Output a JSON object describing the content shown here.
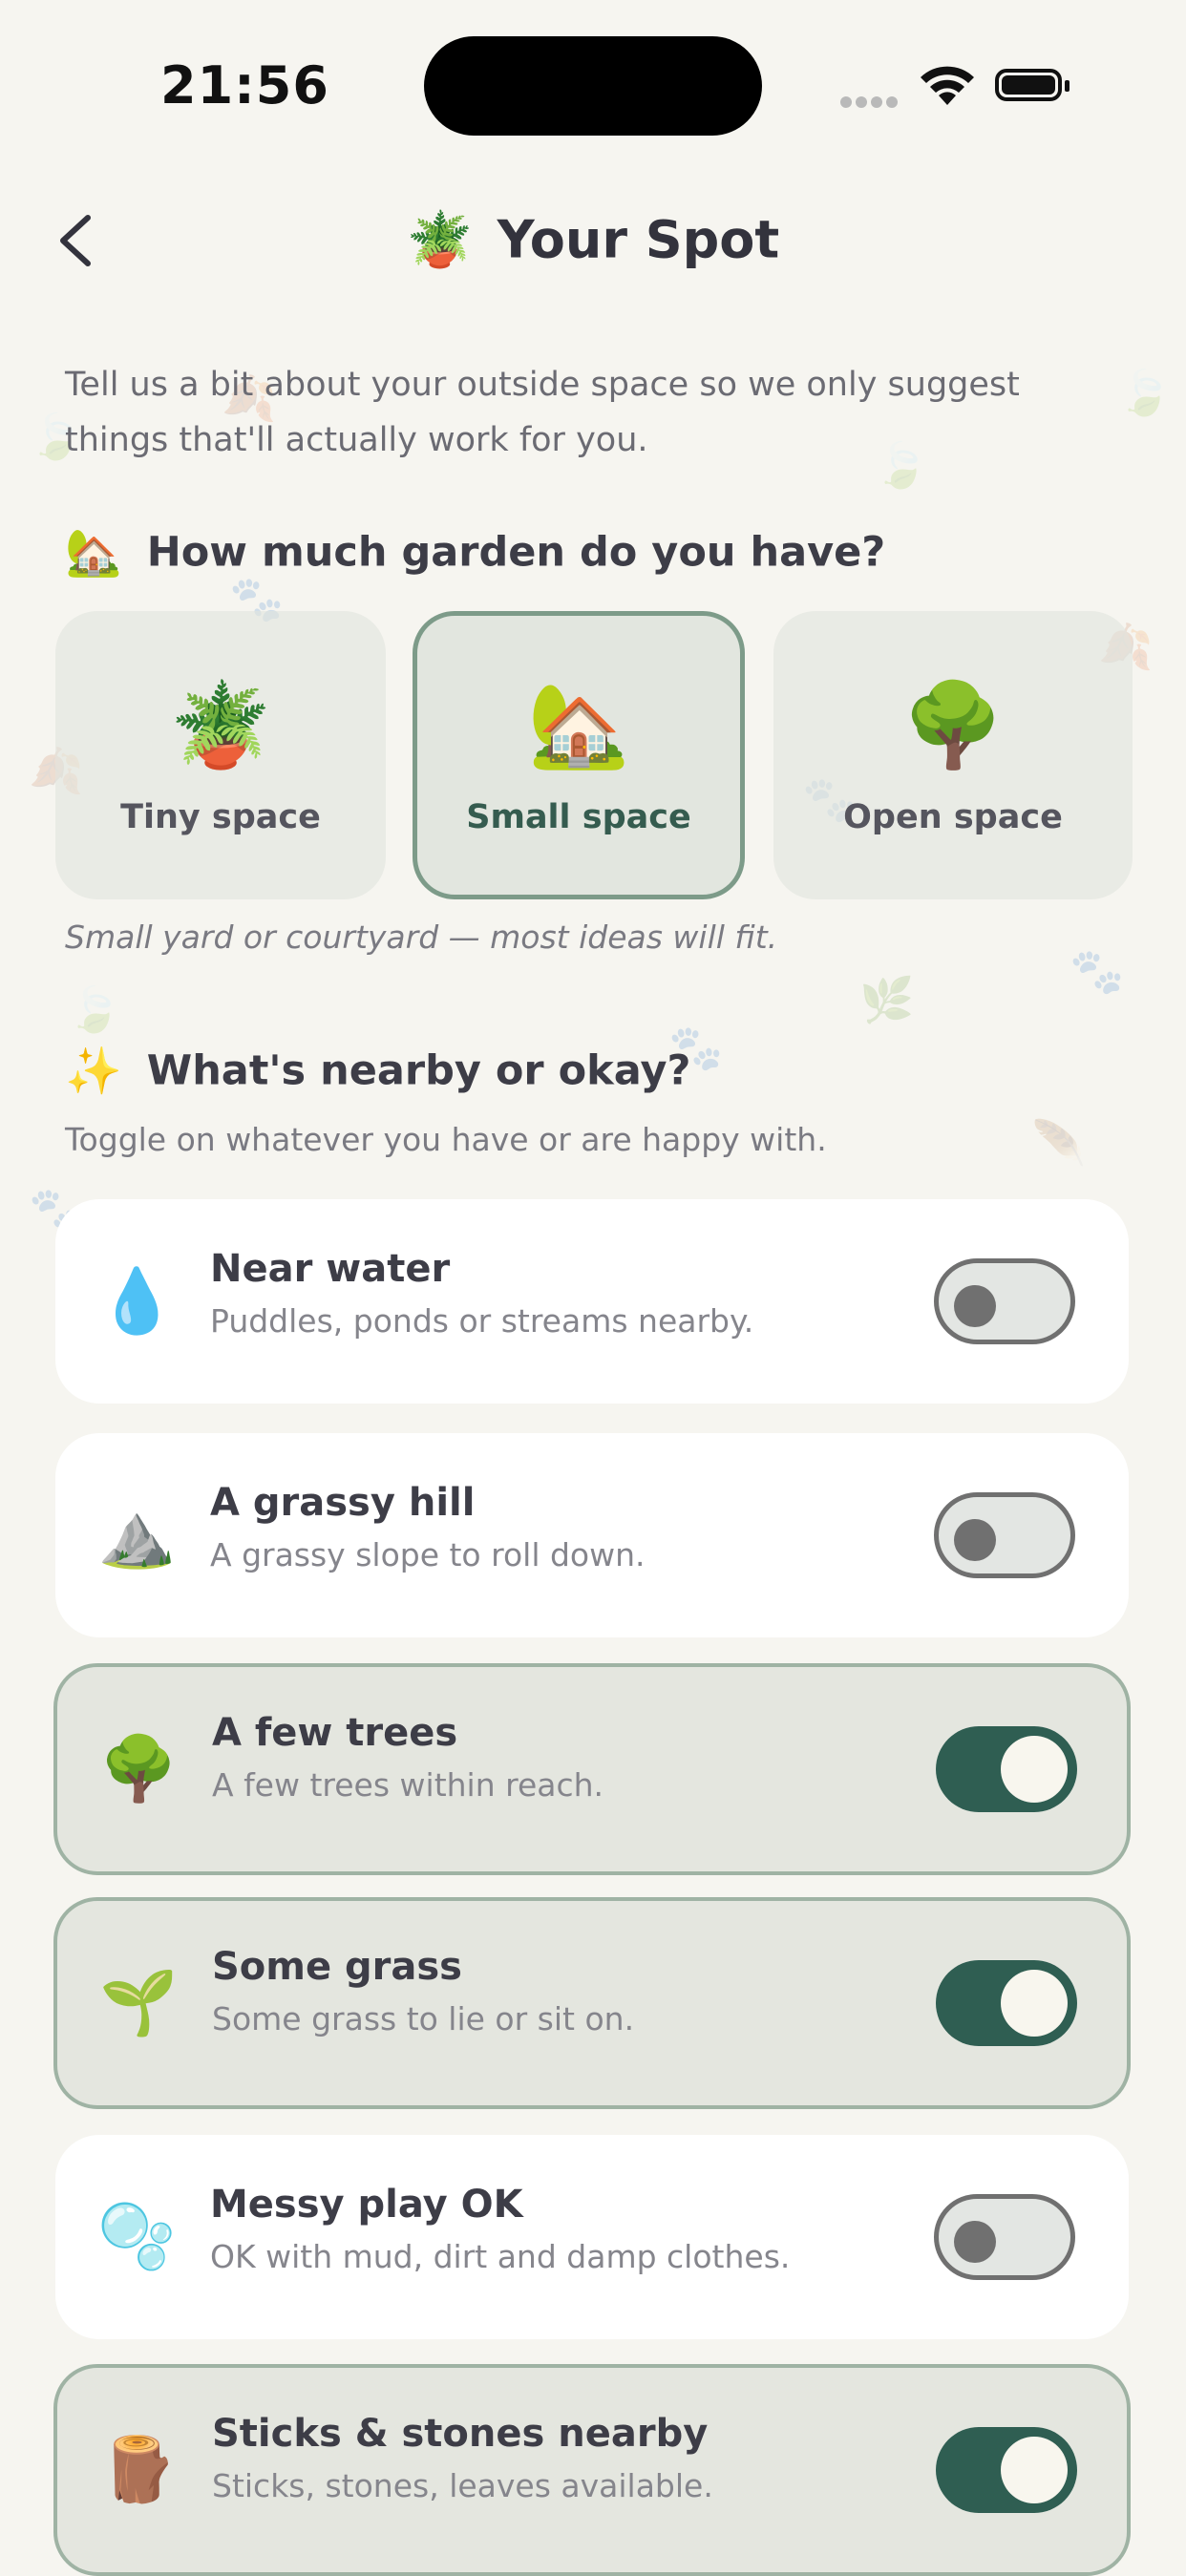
{
  "status_bar": {
    "time": "21:56"
  },
  "header": {
    "emoji": "🪴",
    "title": "Your Spot"
  },
  "intro": "Tell us a bit about your outside space so we only suggest things that'll actually work for you.",
  "garden_section": {
    "emoji": "🏡",
    "heading": "How much garden do you have?",
    "options": [
      {
        "emoji": "🪴",
        "label": "Tiny space",
        "selected": false
      },
      {
        "emoji": "🏡",
        "label": "Small space",
        "selected": true
      },
      {
        "emoji": "🌳",
        "label": "Open space",
        "selected": false
      }
    ],
    "hint": "Small yard or courtyard — most ideas will fit."
  },
  "nearby_section": {
    "emoji": "✨",
    "heading": "What's nearby or okay?",
    "subtext": "Toggle on whatever you have or are happy with.",
    "items": [
      {
        "emoji": "💧",
        "name": "Near water",
        "desc": "Puddles, ponds or streams nearby.",
        "on": false
      },
      {
        "emoji": "⛰️",
        "name": "A grassy hill",
        "desc": "A grassy slope to roll down.",
        "on": false
      },
      {
        "emoji": "🌳",
        "name": "A few trees",
        "desc": "A few trees within reach.",
        "on": true
      },
      {
        "emoji": "🌱",
        "name": "Some grass",
        "desc": "Some grass to lie or sit on.",
        "on": true
      },
      {
        "emoji": "🫧",
        "name": "Messy play OK",
        "desc": "OK with mud, dirt and damp clothes.",
        "on": false
      },
      {
        "emoji": "🪵",
        "name": "Sticks & stones nearby",
        "desc": "Sticks, stones, leaves available.",
        "on": true
      }
    ]
  },
  "colors": {
    "background": "#f6f5f0",
    "accent": "#2f5e52",
    "selected_border": "#7d9b89"
  },
  "icons": {
    "back": "chevron-left-icon",
    "wifi": "wifi-icon",
    "battery": "battery-icon"
  }
}
